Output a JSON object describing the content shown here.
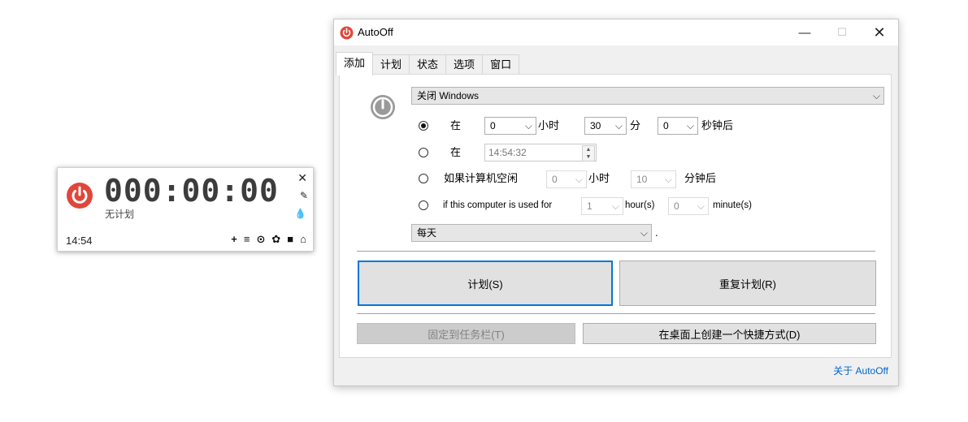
{
  "widget": {
    "time": "000:00:00",
    "status": "无计划",
    "clock": "14:54",
    "close_glyph": "✕",
    "pin_glyph": "📌",
    "drop_glyph": "♦",
    "tools": [
      {
        "name": "add-icon",
        "glyph": "+"
      },
      {
        "name": "list-icon",
        "glyph": "≡"
      },
      {
        "name": "clock-icon",
        "glyph": "⊙"
      },
      {
        "name": "gear-icon",
        "glyph": "✿"
      },
      {
        "name": "lock-icon",
        "glyph": "🔒"
      },
      {
        "name": "home-icon",
        "glyph": "⌂"
      }
    ]
  },
  "window": {
    "title": "AutoOff",
    "min_glyph": "—",
    "max_glyph": "☐",
    "close_glyph": "✕",
    "tabs": [
      "添加",
      "计划",
      "状态",
      "选项",
      "窗口"
    ],
    "active_tab": "添加",
    "action": {
      "value": "关闭 Windows"
    },
    "row1": {
      "label": "在",
      "hours": "0",
      "hours_unit": "小时",
      "minutes": "30",
      "minutes_unit": "分",
      "seconds": "0",
      "seconds_unit": "秒钟后"
    },
    "row2": {
      "label": "在",
      "time": "14:54:32"
    },
    "row3": {
      "label": "如果计算机空闲",
      "hours": "0",
      "hours_unit": "小时",
      "minutes": "10",
      "minutes_unit": "分钟后"
    },
    "row4": {
      "label": "if this computer is used for",
      "hours": "1",
      "hours_unit": "hour(s)",
      "minutes": "0",
      "minutes_unit": "minute(s)"
    },
    "repeat": {
      "value": "每天",
      "suffix": "."
    },
    "buttons": {
      "schedule": "计划(S)",
      "repeat_schedule": "重复计划(R)",
      "pin_taskbar": "固定到任务栏(T)",
      "desktop_shortcut": "在桌面上创建一个快捷方式(D)"
    },
    "about": "关于 AutoOff",
    "selected_radio": 1
  },
  "colors": {
    "accent": "#0078d7",
    "power_red": "#e0463a",
    "link": "#0066cc"
  }
}
